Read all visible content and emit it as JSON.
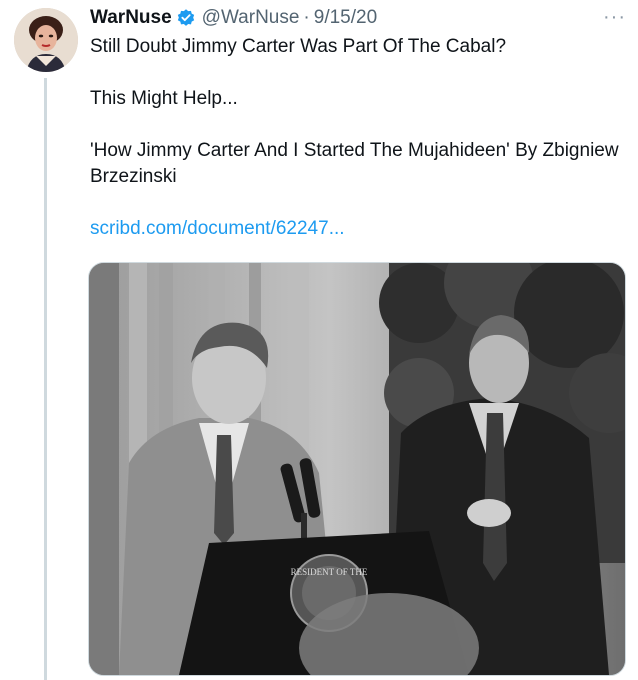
{
  "tweet": {
    "display_name": "WarNuse",
    "handle": "@WarNuse",
    "separator": "·",
    "date": "9/15/20",
    "more_label": "···",
    "line1": "Still Doubt Jimmy Carter Was Part Of The Cabal?",
    "line2": "This Might Help...",
    "line3": "'How Jimmy Carter And I Started The Mujahideen' By Zbigniew Brzezinski",
    "link_text": "scribd.com/document/62247..."
  },
  "media": {
    "seal_text": "RESIDENT OF THE"
  },
  "colors": {
    "link": "#1d9bf0",
    "verified": "#1d9bf0",
    "secondary_text": "#536471"
  }
}
